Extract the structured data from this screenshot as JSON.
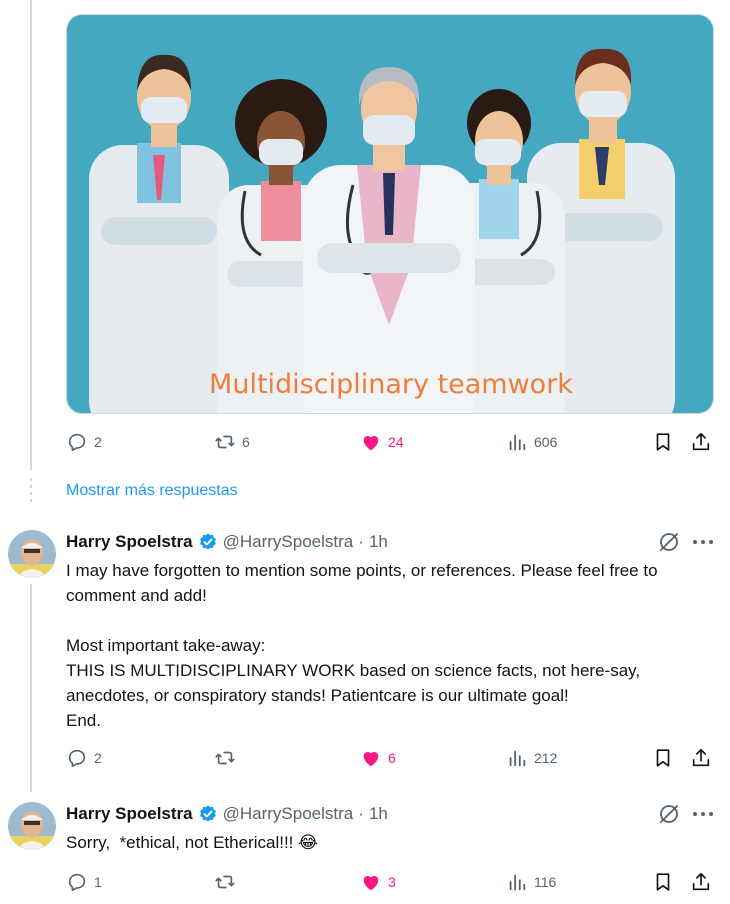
{
  "thread": {
    "media_post": {
      "image_caption": "Multidisciplinary teamwork",
      "stats": {
        "replies": "2",
        "reposts": "6",
        "likes": "24",
        "views": "606"
      }
    },
    "show_more_label": "Mostrar más respuestas",
    "replies": [
      {
        "author_name": "Harry Spoelstra",
        "handle": "@HarrySpoelstra",
        "separator": "·",
        "time": "1h",
        "text": "I may have forgotten to mention some points, or references. Please feel free to comment and add!\n\nMost important take-away:\nTHIS IS MULTIDISCIPLINARY WORK based on science facts, not here-say, anecdotes, or conspiratory stands! Patientcare is our ultimate goal!\nEnd.",
        "stats": {
          "replies": "2",
          "reposts": "",
          "likes": "6",
          "views": "212"
        }
      },
      {
        "author_name": "Harry Spoelstra",
        "handle": "@HarrySpoelstra",
        "separator": "·",
        "time": "1h",
        "text": "Sorry,  *ethical, not Etherical!!! 😂",
        "stats": {
          "replies": "1",
          "reposts": "",
          "likes": "3",
          "views": "116"
        }
      }
    ]
  },
  "colors": {
    "accent": "#1d9bf0",
    "like": "#f91880",
    "muted": "#536471",
    "image_bg": "#45a8c1",
    "caption": "#f07d3a"
  },
  "icons": [
    "reply-icon",
    "repost-icon",
    "heart-icon",
    "views-icon",
    "bookmark-icon",
    "share-icon",
    "verified-icon",
    "grok-icon",
    "more-icon"
  ]
}
